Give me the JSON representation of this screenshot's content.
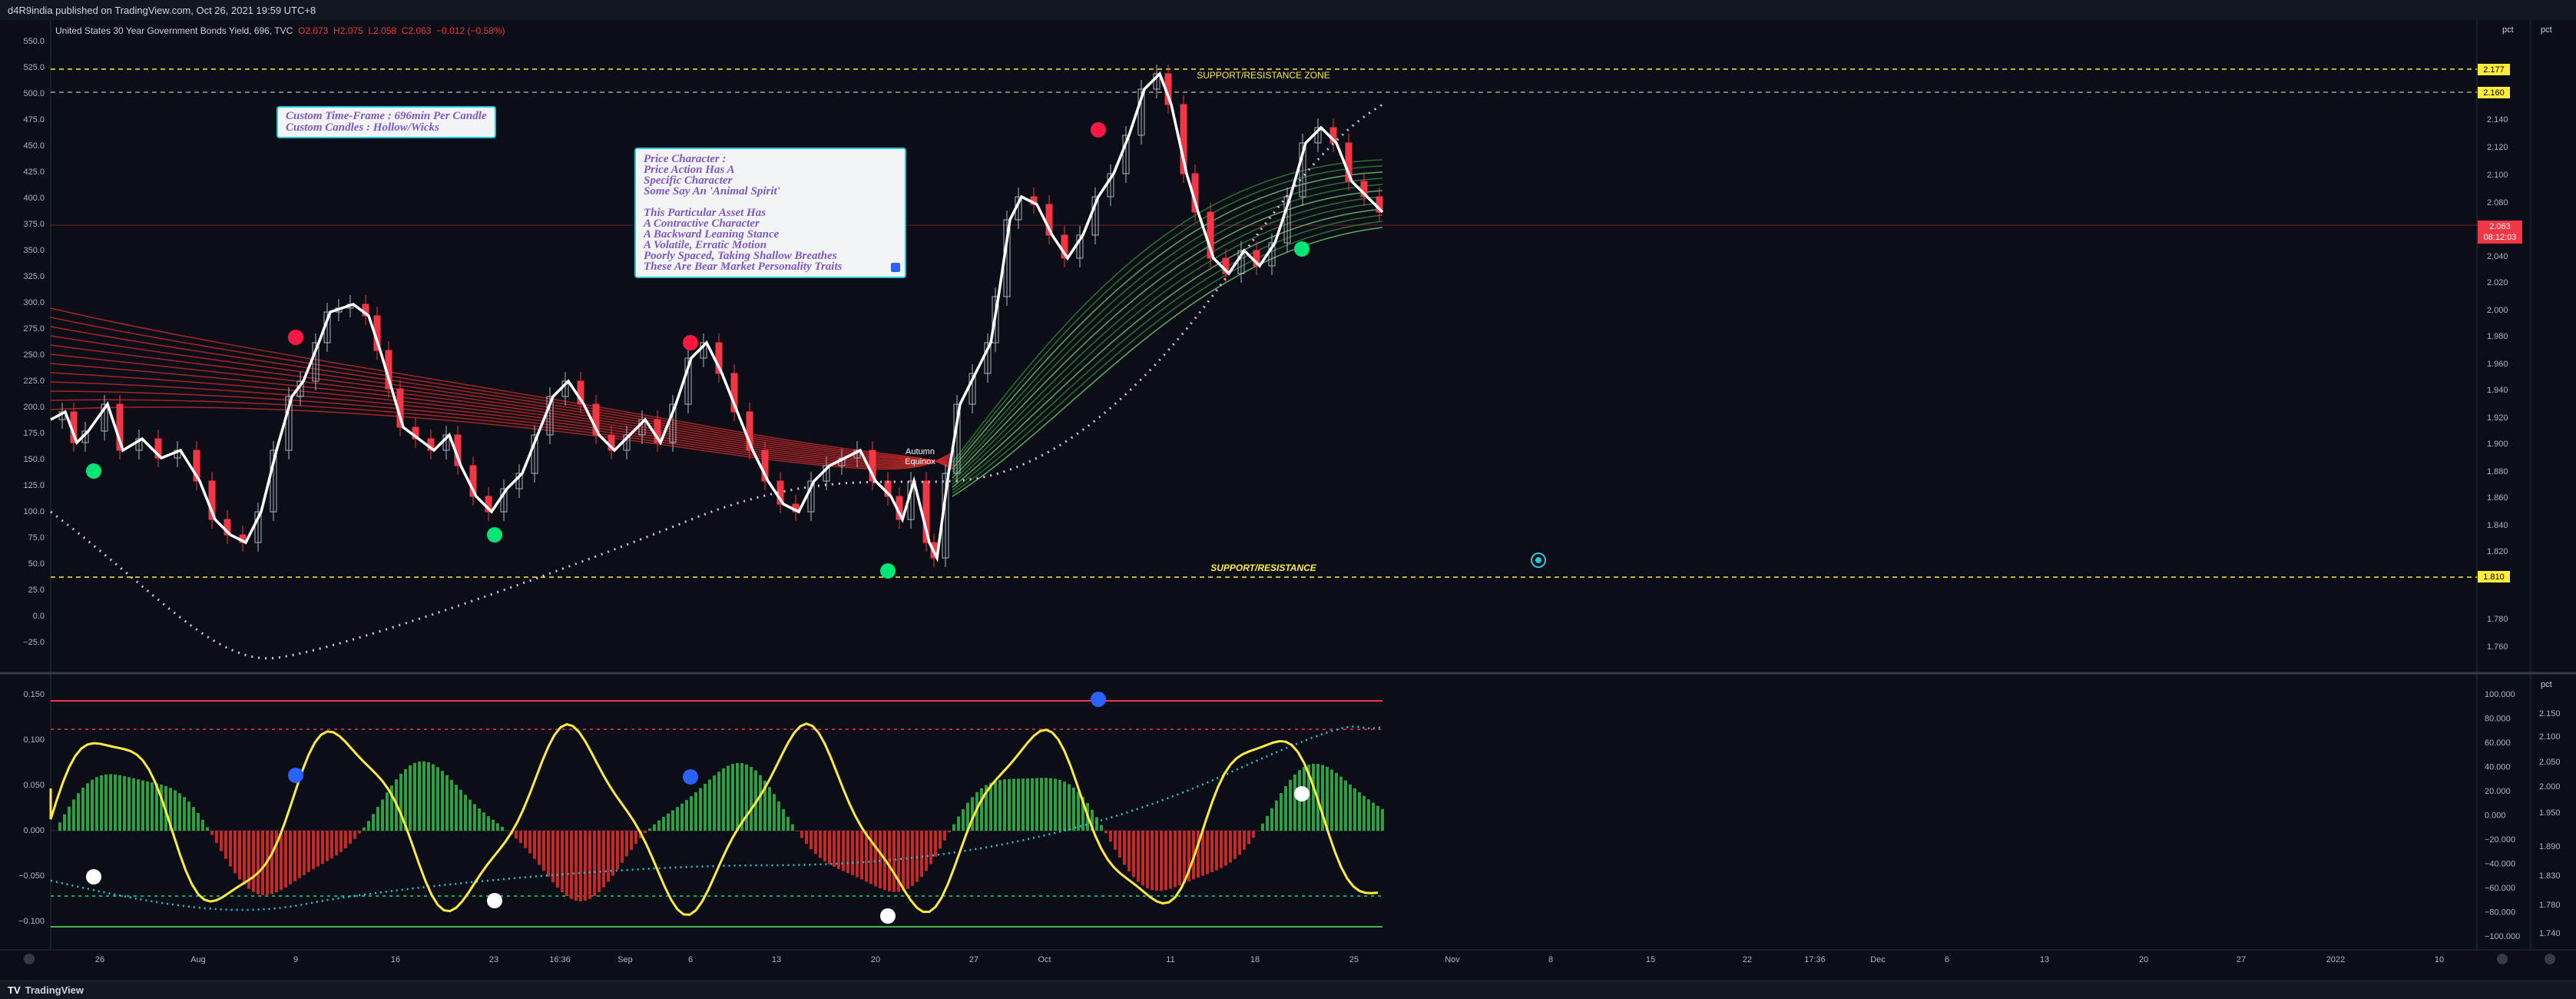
{
  "header": {
    "publisher_text": "d4R9india published on TradingView.com, Oct 26, 2021 19:59 UTC+8"
  },
  "legend": {
    "symbol": "United States 30 Year Government Bonds Yield, 696, TVC",
    "open": "O2.073",
    "high": "H2.075",
    "low": "L2.058",
    "close": "C2.063",
    "change": "−0.012 (−0.58%)"
  },
  "notes": {
    "timeframe": "Custom Time-Frame : 696min Per Candle\nCustom Candles : Hollow/Wicks",
    "character": "Price Character :\nPrice Action Has A\nSpecific Character\nSome Say An 'Animal Spirit'\n\nThis Particular Asset Has\nA Contractive Character\nA Backward Leaning Stance\nA Volatile, Erratic Motion\nPoorly Spaced, Taking Shallow Breathes\nThese Are Bear Market Personality Traits"
  },
  "annotations": {
    "zone_top": "SUPPORT/RESISTANCE ZONE",
    "zone_bottom": "SUPPORT/RESISTANCE",
    "equinox": "Autumn\nEquinox"
  },
  "price_levels": {
    "level_a": "2.177",
    "level_b": "2.160",
    "current": "2.063",
    "countdown": "08:12:03",
    "level_low": "1.810",
    "colors": {
      "level": "#ffeb3b",
      "current": "#f23645"
    }
  },
  "axes": {
    "main_left": [
      "550.0",
      "525.0",
      "500.0",
      "475.0",
      "450.0",
      "425.0",
      "400.0",
      "375.0",
      "350.0",
      "325.0",
      "300.0",
      "275.0",
      "250.0",
      "225.0",
      "200.0",
      "175.0",
      "150.0",
      "125.0",
      "100.0",
      "75.0",
      "50.0",
      "25.0",
      "0.0",
      "−25.0"
    ],
    "main_right": [
      "2.140",
      "2.120",
      "2.100",
      "2.080",
      "2.040",
      "2.020",
      "2.000",
      "1.980",
      "1.960",
      "1.940",
      "1.920",
      "1.900",
      "1.880",
      "1.860",
      "1.840",
      "1.820",
      "1.800",
      "1.780",
      "1.760"
    ],
    "osc_left": [
      "0.150",
      "0.100",
      "0.050",
      "0.000",
      "−0.050",
      "−0.100"
    ],
    "osc_right1": [
      "100.000",
      "80.000",
      "60.000",
      "40.000",
      "20.000",
      "0.000",
      "−20.000",
      "−40.000",
      "−60.000",
      "−80.000",
      "−100.000"
    ],
    "osc_right2": [
      "2.150",
      "2.100",
      "2.050",
      "2.000",
      "1.950",
      "1.890",
      "1.830",
      "1.780",
      "1.740"
    ],
    "pct_label": "pct",
    "time": [
      "26",
      "Aug",
      "9",
      "16",
      "23",
      "16:36",
      "Sep",
      "6",
      "13",
      "20",
      "27",
      "Oct",
      "11",
      "18",
      "25",
      "Nov",
      "8",
      "15",
      "22",
      "17:36",
      "Dec",
      "6",
      "13",
      "20",
      "27",
      "2022",
      "10"
    ]
  },
  "footer": {
    "brand": "TradingView"
  }
}
